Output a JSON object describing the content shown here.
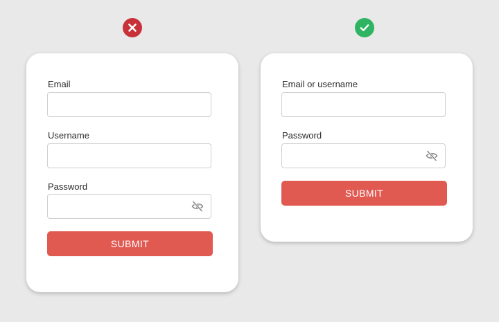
{
  "colors": {
    "bad_badge": "#c9313a",
    "good_badge": "#2fb463",
    "button": "#e05a52"
  },
  "badges": {
    "bad_icon": "close-x-icon",
    "good_icon": "checkmark-icon"
  },
  "bad_form": {
    "email_label": "Email",
    "email_value": "",
    "username_label": "Username",
    "username_value": "",
    "password_label": "Password",
    "password_value": "",
    "password_toggle_icon": "eye-off-icon",
    "submit_label": "SUBMIT"
  },
  "good_form": {
    "email_or_username_label": "Email or username",
    "email_or_username_value": "",
    "password_label": "Password",
    "password_value": "",
    "password_toggle_icon": "eye-off-icon",
    "submit_label": "SUBMIT"
  }
}
